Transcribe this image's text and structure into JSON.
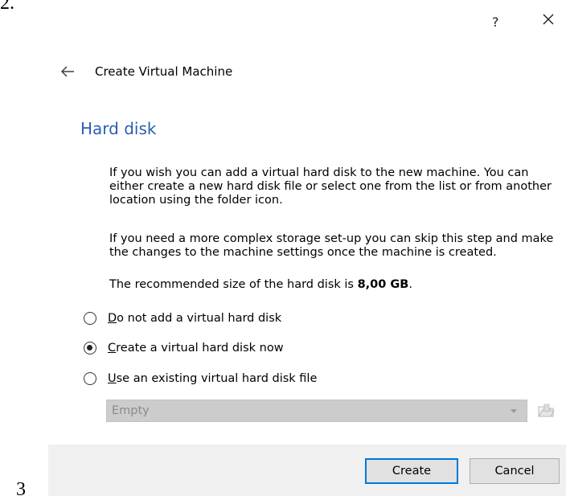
{
  "margin": {
    "top_label": "2.",
    "bottom_label": "3"
  },
  "window": {
    "help_label": "?",
    "close_icon": "close-icon"
  },
  "wizard": {
    "back_icon": "back-arrow-icon",
    "title": "Create Virtual Machine"
  },
  "page": {
    "heading": "Hard disk",
    "paragraph_1": "If you wish you can add a virtual hard disk to the new machine. You can\neither create a new hard disk file or select one from the list or from another\nlocation using the folder icon.",
    "paragraph_2": "If you need a more complex storage set-up you can skip this step and make\nthe changes to the machine settings once the machine is created.",
    "recommended_prefix": "The recommended size of the hard disk is ",
    "recommended_size": "8,00 GB",
    "recommended_suffix": "."
  },
  "options": [
    {
      "mnemonic": "D",
      "rest": "o not add a virtual hard disk",
      "checked": false
    },
    {
      "mnemonic": "C",
      "rest": "reate a virtual hard disk now",
      "checked": true
    },
    {
      "mnemonic": "U",
      "rest": "se an existing virtual hard disk file",
      "checked": false
    }
  ],
  "disk_selector": {
    "value": "Empty",
    "disabled": true,
    "folder_icon": "folder-icon"
  },
  "buttons": {
    "create": "Create",
    "cancel": "Cancel"
  },
  "colors": {
    "heading": "#2a5fb0",
    "default_button_border": "#0078d7",
    "footer_bg": "#f0f0f0",
    "disabled_combo_bg": "#cccccc"
  }
}
